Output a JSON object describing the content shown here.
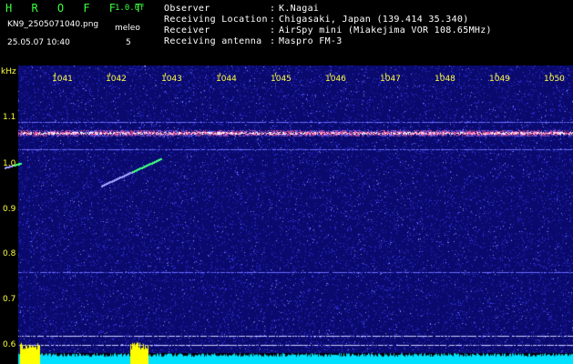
{
  "header": {
    "app_name": "H R O F F T",
    "version": "1.0.0f",
    "filename": "KN9_2505071040.png",
    "mode_label": "meleo",
    "timestamp": "25.05.07 10:40",
    "mode_value": "5",
    "info": [
      {
        "label": "Observer",
        "value": "K.Nagai"
      },
      {
        "label": "Receiving Location",
        "value": "Chigasaki, Japan (139.414 35.340)"
      },
      {
        "label": "Receiver",
        "value": "AirSpy mini (Miakejima VOR 108.65MHz)"
      },
      {
        "label": "Receiving antenna",
        "value": "Maspro FM-3"
      }
    ]
  },
  "axes": {
    "unit_label": "kHz",
    "x_ticks": [
      "1041",
      "1042",
      "1043",
      "1044",
      "1045",
      "1046",
      "1047",
      "1048",
      "1049",
      "1050"
    ],
    "y_ticks": [
      "1.1",
      "1.0",
      "0.9",
      "0.8",
      "0.7",
      "0.6"
    ]
  },
  "colors": {
    "background": "#000000",
    "waterfall_base": "#0a0a6e",
    "noise": "#3a3aff",
    "carrier": "#ff60a0",
    "tick_text": "#ffff40",
    "header_text": "#3cff3c",
    "trace_yellow": "#ffff00",
    "trace_cyan": "#00e0ff"
  },
  "signals": {
    "carrier_khz": 1.065,
    "lines_khz": [
      1.09,
      1.03,
      0.76,
      0.62,
      0.6
    ],
    "meteor_echoes": [
      {
        "from_khz": 0.99,
        "to_khz": 1.0,
        "from_time": 1040.1,
        "to_time": 1040.4
      },
      {
        "from_khz": 0.95,
        "to_khz": 1.01,
        "from_time": 1041.85,
        "to_time": 1042.95
      }
    ]
  }
}
